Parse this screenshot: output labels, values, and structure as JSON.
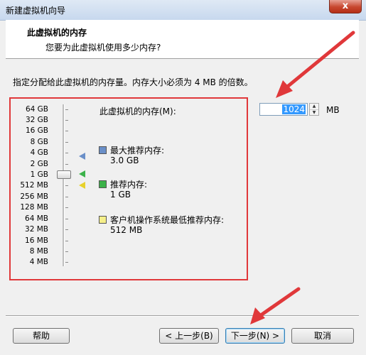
{
  "window": {
    "title": "新建虚拟机向导",
    "close_label": "x"
  },
  "header": {
    "title": "此虚拟机的内存",
    "subtitle": "您要为此虚拟机使用多少内存?"
  },
  "description": "指定分配给此虚拟机的内存量。内存大小必须为 4 MB 的倍数。",
  "memory": {
    "label": "此虚拟机的内存(M):",
    "value": "1024",
    "unit": "MB",
    "slider_selected": "1 GB"
  },
  "slider_ticks": [
    "64 GB",
    "32 GB",
    "16 GB",
    "8 GB",
    "4 GB",
    "2 GB",
    "1 GB",
    "512 MB",
    "256 MB",
    "128 MB",
    "64 MB",
    "32 MB",
    "16 MB",
    "8 MB",
    "4 MB"
  ],
  "recommendations": [
    {
      "label": "最大推荐内存:",
      "value": "3.0 GB",
      "color": "#6a8fc8"
    },
    {
      "label": "推荐内存:",
      "value": "1 GB",
      "color": "#3cb24a"
    },
    {
      "label": "客户机操作系统最低推荐内存:",
      "value": "512 MB",
      "color": "#f5ef8a"
    }
  ],
  "buttons": {
    "help": "帮助",
    "back": "< 上一步(B)",
    "next": "下一步(N) >",
    "cancel": "取消"
  },
  "annotation_color": "#e0383a"
}
